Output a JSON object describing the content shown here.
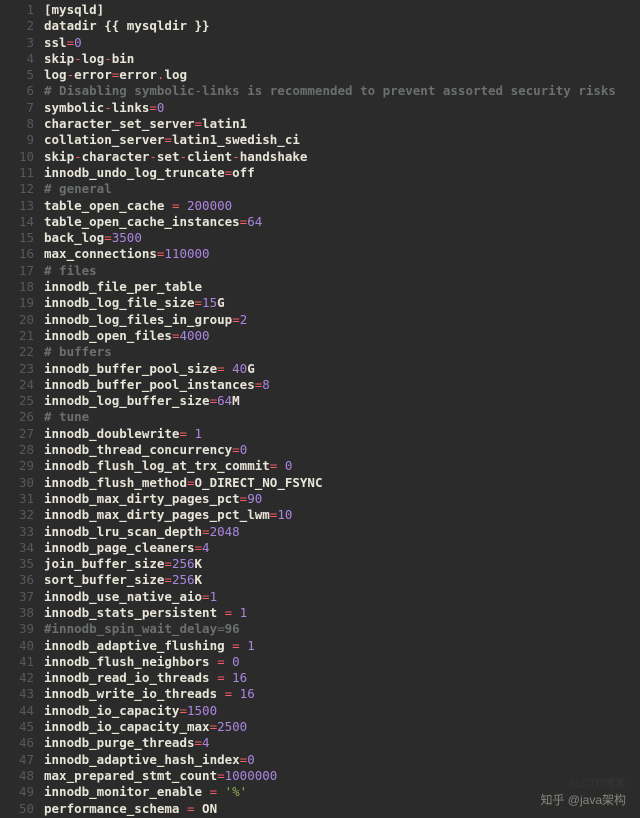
{
  "watermark": "知乎 @java架构",
  "watermark2": "51CTO博客",
  "lines": [
    {
      "n": 1,
      "tokens": [
        [
          "sec",
          "[mysqld]"
        ]
      ]
    },
    {
      "n": 2,
      "tokens": [
        [
          "key",
          "datadir "
        ],
        [
          "val",
          "{{ mysqldir }}"
        ]
      ]
    },
    {
      "n": 3,
      "tokens": [
        [
          "key",
          "ssl"
        ],
        [
          "eq",
          "="
        ],
        [
          "num",
          "0"
        ]
      ]
    },
    {
      "n": 4,
      "tokens": [
        [
          "key",
          "skip"
        ],
        [
          "dash",
          "-"
        ],
        [
          "key",
          "log"
        ],
        [
          "dash",
          "-"
        ],
        [
          "key",
          "bin"
        ]
      ]
    },
    {
      "n": 5,
      "tokens": [
        [
          "key",
          "log"
        ],
        [
          "dash",
          "-"
        ],
        [
          "key",
          "error"
        ],
        [
          "eq",
          "="
        ],
        [
          "key",
          "error"
        ],
        [
          "dot",
          "."
        ],
        [
          "key",
          "log"
        ]
      ]
    },
    {
      "n": 6,
      "tokens": [
        [
          "cmt",
          "# Disabling symbolic"
        ],
        [
          "cmtd",
          "-"
        ],
        [
          "cmt",
          "links is recommended to prevent assorted security risks"
        ]
      ]
    },
    {
      "n": 7,
      "tokens": [
        [
          "key",
          "symbolic"
        ],
        [
          "dash",
          "-"
        ],
        [
          "key",
          "links"
        ],
        [
          "eq",
          "="
        ],
        [
          "num",
          "0"
        ]
      ]
    },
    {
      "n": 8,
      "tokens": [
        [
          "key",
          "character_set_server"
        ],
        [
          "eq",
          "="
        ],
        [
          "key",
          "latin1"
        ]
      ]
    },
    {
      "n": 9,
      "tokens": [
        [
          "key",
          "collation_server"
        ],
        [
          "eq",
          "="
        ],
        [
          "key",
          "latin1_swedish_ci"
        ]
      ]
    },
    {
      "n": 10,
      "tokens": [
        [
          "key",
          "skip"
        ],
        [
          "dash",
          "-"
        ],
        [
          "key",
          "character"
        ],
        [
          "dash",
          "-"
        ],
        [
          "key",
          "set"
        ],
        [
          "dash",
          "-"
        ],
        [
          "key",
          "client"
        ],
        [
          "dash",
          "-"
        ],
        [
          "key",
          "handshake"
        ]
      ]
    },
    {
      "n": 11,
      "tokens": [
        [
          "key",
          "innodb_undo_log_truncate"
        ],
        [
          "eq",
          "="
        ],
        [
          "key",
          "off"
        ]
      ]
    },
    {
      "n": 12,
      "tokens": [
        [
          "cmt",
          "# general"
        ]
      ]
    },
    {
      "n": 13,
      "tokens": [
        [
          "key",
          "table_open_cache"
        ],
        [
          "eq",
          " = "
        ],
        [
          "num",
          "200000"
        ]
      ]
    },
    {
      "n": 14,
      "tokens": [
        [
          "key",
          "table_open_cache_instances"
        ],
        [
          "eq",
          "="
        ],
        [
          "num",
          "64"
        ]
      ]
    },
    {
      "n": 15,
      "tokens": [
        [
          "key",
          "back_log"
        ],
        [
          "eq",
          "="
        ],
        [
          "num",
          "3500"
        ]
      ]
    },
    {
      "n": 16,
      "tokens": [
        [
          "key",
          "max_connections"
        ],
        [
          "eq",
          "="
        ],
        [
          "num",
          "110000"
        ]
      ]
    },
    {
      "n": 17,
      "tokens": [
        [
          "cmt",
          "# files"
        ]
      ]
    },
    {
      "n": 18,
      "tokens": [
        [
          "key",
          "innodb_file_per_table"
        ]
      ]
    },
    {
      "n": 19,
      "tokens": [
        [
          "key",
          "innodb_log_file_size"
        ],
        [
          "eq",
          "="
        ],
        [
          "num",
          "15"
        ],
        [
          "key",
          "G"
        ]
      ]
    },
    {
      "n": 20,
      "tokens": [
        [
          "key",
          "innodb_log_files_in_group"
        ],
        [
          "eq",
          "="
        ],
        [
          "num",
          "2"
        ]
      ]
    },
    {
      "n": 21,
      "tokens": [
        [
          "key",
          "innodb_open_files"
        ],
        [
          "eq",
          "="
        ],
        [
          "num",
          "4000"
        ]
      ]
    },
    {
      "n": 22,
      "tokens": [
        [
          "cmt",
          "# buffers"
        ]
      ]
    },
    {
      "n": 23,
      "tokens": [
        [
          "key",
          "innodb_buffer_pool_size"
        ],
        [
          "eq",
          "= "
        ],
        [
          "num",
          "40"
        ],
        [
          "key",
          "G"
        ]
      ]
    },
    {
      "n": 24,
      "tokens": [
        [
          "key",
          "innodb_buffer_pool_instances"
        ],
        [
          "eq",
          "="
        ],
        [
          "num",
          "8"
        ]
      ]
    },
    {
      "n": 25,
      "tokens": [
        [
          "key",
          "innodb_log_buffer_size"
        ],
        [
          "eq",
          "="
        ],
        [
          "num",
          "64"
        ],
        [
          "key",
          "M"
        ]
      ]
    },
    {
      "n": 26,
      "tokens": [
        [
          "cmt",
          "# tune"
        ]
      ]
    },
    {
      "n": 27,
      "tokens": [
        [
          "key",
          "innodb_doublewrite"
        ],
        [
          "eq",
          "= "
        ],
        [
          "num",
          "1"
        ]
      ]
    },
    {
      "n": 28,
      "tokens": [
        [
          "key",
          "innodb_thread_concurrency"
        ],
        [
          "eq",
          "="
        ],
        [
          "num",
          "0"
        ]
      ]
    },
    {
      "n": 29,
      "tokens": [
        [
          "key",
          "innodb_flush_log_at_trx_commit"
        ],
        [
          "eq",
          "= "
        ],
        [
          "num",
          "0"
        ]
      ]
    },
    {
      "n": 30,
      "tokens": [
        [
          "key",
          "innodb_flush_method"
        ],
        [
          "eq",
          "="
        ],
        [
          "key",
          "O_DIRECT_NO_FSYNC"
        ]
      ]
    },
    {
      "n": 31,
      "tokens": [
        [
          "key",
          "innodb_max_dirty_pages_pct"
        ],
        [
          "eq",
          "="
        ],
        [
          "num",
          "90"
        ]
      ]
    },
    {
      "n": 32,
      "tokens": [
        [
          "key",
          "innodb_max_dirty_pages_pct_lwm"
        ],
        [
          "eq",
          "="
        ],
        [
          "num",
          "10"
        ]
      ]
    },
    {
      "n": 33,
      "tokens": [
        [
          "key",
          "innodb_lru_scan_depth"
        ],
        [
          "eq",
          "="
        ],
        [
          "num",
          "2048"
        ]
      ]
    },
    {
      "n": 34,
      "tokens": [
        [
          "key",
          "innodb_page_cleaners"
        ],
        [
          "eq",
          "="
        ],
        [
          "num",
          "4"
        ]
      ]
    },
    {
      "n": 35,
      "tokens": [
        [
          "key",
          "join_buffer_size"
        ],
        [
          "eq",
          "="
        ],
        [
          "num",
          "256"
        ],
        [
          "key",
          "K"
        ]
      ]
    },
    {
      "n": 36,
      "tokens": [
        [
          "key",
          "sort_buffer_size"
        ],
        [
          "eq",
          "="
        ],
        [
          "num",
          "256"
        ],
        [
          "key",
          "K"
        ]
      ]
    },
    {
      "n": 37,
      "tokens": [
        [
          "key",
          "innodb_use_native_aio"
        ],
        [
          "eq",
          "="
        ],
        [
          "num",
          "1"
        ]
      ]
    },
    {
      "n": 38,
      "tokens": [
        [
          "key",
          "innodb_stats_persistent"
        ],
        [
          "eq",
          " = "
        ],
        [
          "num",
          "1"
        ]
      ]
    },
    {
      "n": 39,
      "tokens": [
        [
          "cmt",
          "#innodb_spin_wait_delay"
        ],
        [
          "cmtd",
          "="
        ],
        [
          "cmt",
          "96"
        ]
      ]
    },
    {
      "n": 40,
      "tokens": [
        [
          "key",
          "innodb_adaptive_flushing"
        ],
        [
          "eq",
          " = "
        ],
        [
          "num",
          "1"
        ]
      ]
    },
    {
      "n": 41,
      "tokens": [
        [
          "key",
          "innodb_flush_neighbors"
        ],
        [
          "eq",
          " = "
        ],
        [
          "num",
          "0"
        ]
      ]
    },
    {
      "n": 42,
      "tokens": [
        [
          "key",
          "innodb_read_io_threads"
        ],
        [
          "eq",
          " = "
        ],
        [
          "num",
          "16"
        ]
      ]
    },
    {
      "n": 43,
      "tokens": [
        [
          "key",
          "innodb_write_io_threads"
        ],
        [
          "eq",
          " = "
        ],
        [
          "num",
          "16"
        ]
      ]
    },
    {
      "n": 44,
      "tokens": [
        [
          "key",
          "innodb_io_capacity"
        ],
        [
          "eq",
          "="
        ],
        [
          "num",
          "1500"
        ]
      ]
    },
    {
      "n": 45,
      "tokens": [
        [
          "key",
          "innodb_io_capacity_max"
        ],
        [
          "eq",
          "="
        ],
        [
          "num",
          "2500"
        ]
      ]
    },
    {
      "n": 46,
      "tokens": [
        [
          "key",
          "innodb_purge_threads"
        ],
        [
          "eq",
          "="
        ],
        [
          "num",
          "4"
        ]
      ]
    },
    {
      "n": 47,
      "tokens": [
        [
          "key",
          "innodb_adaptive_hash_index"
        ],
        [
          "eq",
          "="
        ],
        [
          "num",
          "0"
        ]
      ]
    },
    {
      "n": 48,
      "tokens": [
        [
          "key",
          "max_prepared_stmt_count"
        ],
        [
          "eq",
          "="
        ],
        [
          "num",
          "1000000"
        ]
      ]
    },
    {
      "n": 49,
      "tokens": [
        [
          "key",
          "innodb_monitor_enable"
        ],
        [
          "eq",
          " = "
        ],
        [
          "str",
          "'%'"
        ]
      ]
    },
    {
      "n": 50,
      "tokens": [
        [
          "key",
          "performance_schema"
        ],
        [
          "eq",
          " = "
        ],
        [
          "key",
          "ON"
        ]
      ]
    }
  ]
}
